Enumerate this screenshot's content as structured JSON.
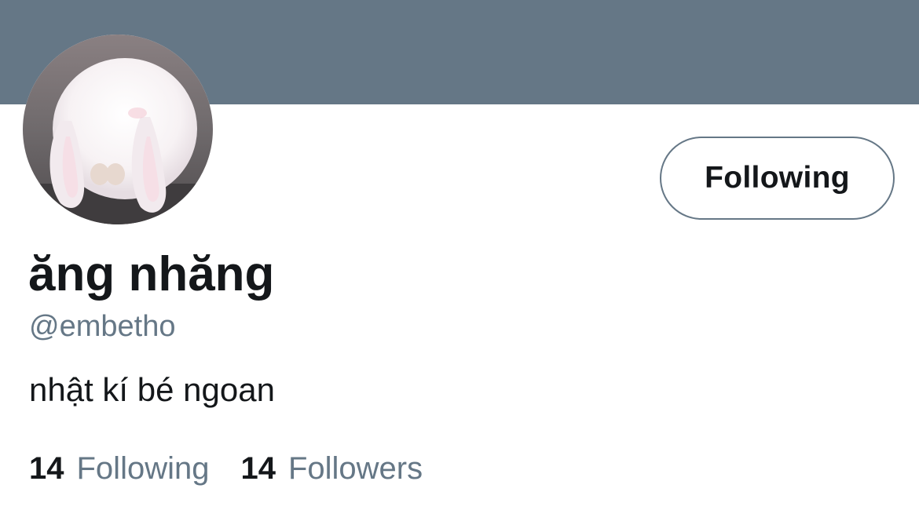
{
  "profile": {
    "display_name": "ăng nhăng",
    "handle": "@embetho",
    "bio": "nhật kí bé ngoan",
    "avatar_icon": "bunny-avatar"
  },
  "actions": {
    "follow_button_label": "Following"
  },
  "stats": {
    "following_count": "14",
    "following_label": "Following",
    "followers_count": "14",
    "followers_label": "Followers"
  },
  "colors": {
    "banner": "#657786",
    "text_primary": "#14171a",
    "text_secondary": "#657786",
    "button_border": "#657786"
  }
}
